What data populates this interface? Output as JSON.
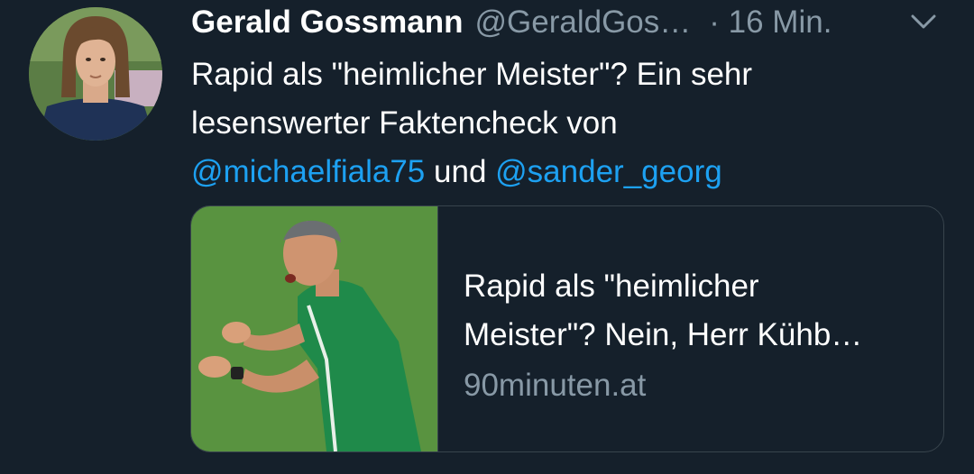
{
  "tweet": {
    "author_name": "Gerald Gossmann",
    "handle": "@GeraldGos…",
    "time": "· 16 Min.",
    "menu_icon": "chevron-down-icon",
    "text_part1": "Rapid als \"heimlicher Meister\"? Ein sehr lesenswerter Faktencheck von",
    "mention1": "@michaelfiala75",
    "text_part2": "und",
    "mention2": "@sander_georg"
  },
  "card": {
    "title_line1": "Rapid als \"heimlicher",
    "title_line2": "Meister\"? Nein, Herr Kühb…",
    "domain": "90minuten.at"
  },
  "colors": {
    "background": "#15202b",
    "text": "#ffffff",
    "secondary": "#8899a6",
    "link": "#1da1f2",
    "border": "#38444d"
  }
}
